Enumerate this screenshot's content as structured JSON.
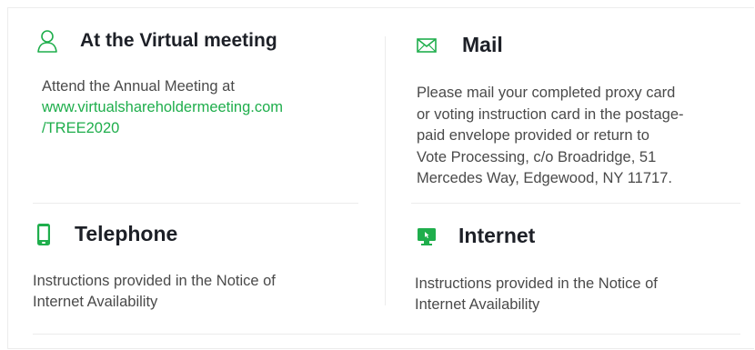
{
  "sections": {
    "virtual": {
      "icon": "person-icon",
      "title": "At the Virtual meeting",
      "text": "Attend the Annual Meeting at",
      "link_line1": "www.virtualshareholdermeeting.com",
      "link_line2": "/TREE2020"
    },
    "mail": {
      "icon": "envelope-icon",
      "title": "Mail",
      "lines": [
        "Please mail your completed proxy card",
        "or voting instruction card in the postage-",
        "paid envelope provided or return to",
        "Vote Processing, c/o Broadridge, 51",
        "Mercedes Way, Edgewood, NY 11717."
      ]
    },
    "telephone": {
      "icon": "phone-icon",
      "title": "Telephone",
      "lines": [
        "Instructions provided in the Notice of",
        "Internet Availability"
      ]
    },
    "internet": {
      "icon": "monitor-icon",
      "title": "Internet",
      "lines": [
        "Instructions provided in the Notice of",
        "Internet Availability"
      ]
    }
  },
  "colors": {
    "accent": "#1fae4c",
    "heading": "#1d2027",
    "body": "#4a4a4a",
    "divider": "#ececec"
  }
}
